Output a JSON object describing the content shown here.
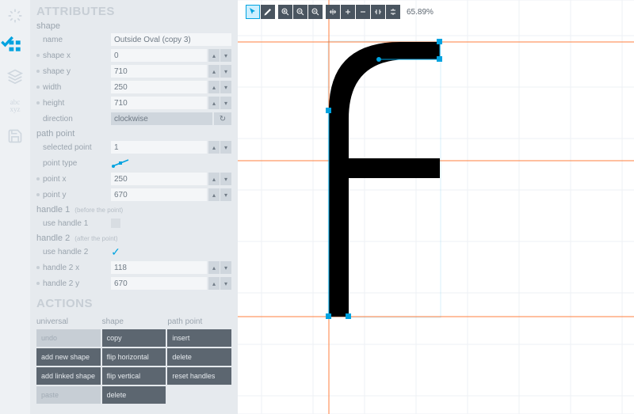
{
  "headers": {
    "attributes": "ATTRIBUTES",
    "shape": "shape",
    "path_point": "path point",
    "handle1": "handle 1",
    "handle1_sub": "(before the point)",
    "handle2": "handle 2",
    "handle2_sub": "(after the point)",
    "actions": "ACTIONS"
  },
  "labels": {
    "name": "name",
    "shape_x": "shape x",
    "shape_y": "shape y",
    "width": "width",
    "height": "height",
    "direction": "direction",
    "selected_point": "selected point",
    "point_type": "point type",
    "point_x": "point x",
    "point_y": "point y",
    "use_handle_1": "use handle 1",
    "use_handle_2": "use handle 2",
    "handle_2_x": "handle 2 x",
    "handle_2_y": "handle 2 y"
  },
  "values": {
    "name": "Outside Oval (copy 3)",
    "shape_x": "0",
    "shape_y": "710",
    "width": "250",
    "height": "710",
    "direction": "clockwise",
    "selected_point": "1",
    "point_x": "250",
    "point_y": "670",
    "handle_2_x": "118",
    "handle_2_y": "670"
  },
  "actions": {
    "universal": {
      "title": "universal",
      "items": [
        "undo",
        "add new shape",
        "add linked shape",
        "paste"
      ]
    },
    "shape": {
      "title": "shape",
      "items": [
        "copy",
        "flip horizontal",
        "flip vertical",
        "delete"
      ]
    },
    "pathpoint": {
      "title": "path point",
      "items": [
        "insert",
        "delete",
        "reset handles"
      ]
    }
  },
  "toolbar": {
    "zoom": "65.89%"
  }
}
